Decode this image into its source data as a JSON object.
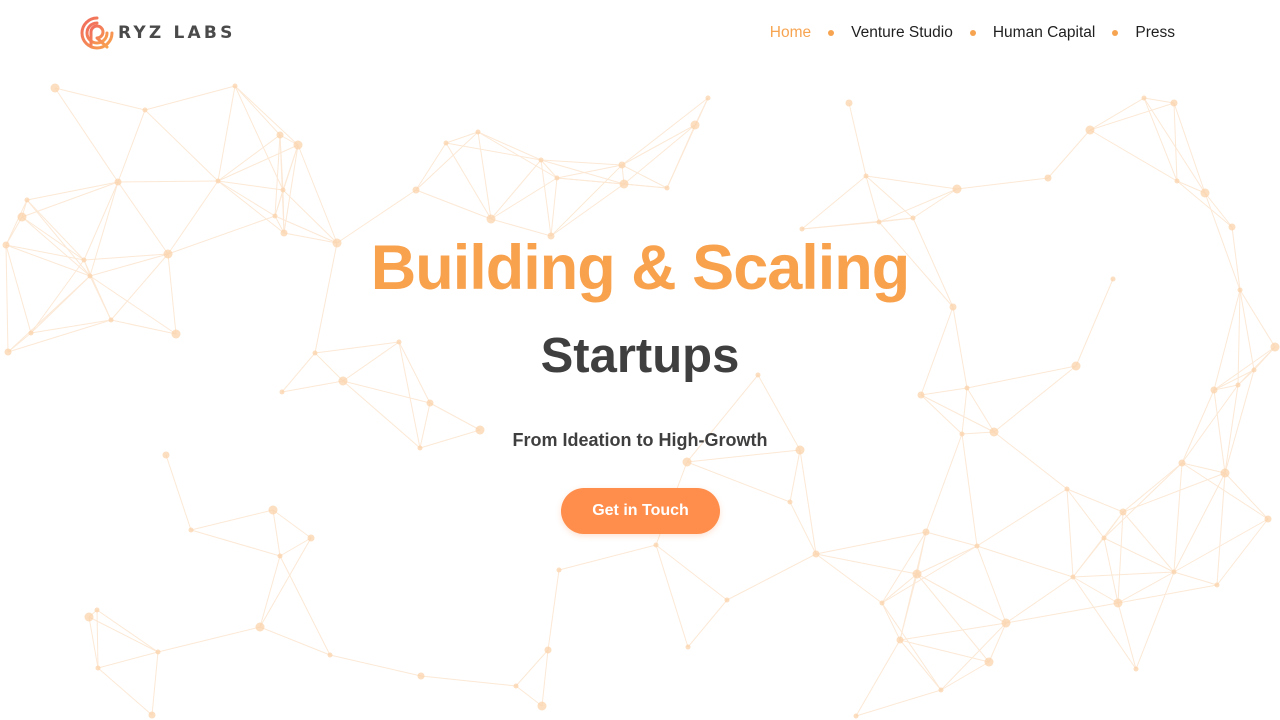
{
  "brand": {
    "name": "RYZ LABS",
    "logo_icon": "ryz-logo-icon",
    "gradient_start": "#f06a5e",
    "gradient_end": "#f9a24e"
  },
  "nav": {
    "items": [
      {
        "label": "Home",
        "active": true
      },
      {
        "label": "Venture Studio",
        "active": false
      },
      {
        "label": "Human Capital",
        "active": false
      },
      {
        "label": "Press",
        "active": false
      }
    ],
    "separator_icon": "dot-separator-icon"
  },
  "hero": {
    "title": "Building & Scaling",
    "subtitle": "Startups",
    "tagline": "From Ideation to High-Growth",
    "cta_label": "Get in Touch",
    "background": "network-mesh-graphic"
  },
  "colors": {
    "accent": "#f9a24e",
    "button": "#ff8d4b",
    "nav_active": "#f7a451",
    "text_dark": "#3f3f3f",
    "background": "#ffffff",
    "mesh_line": "#f7c08a"
  }
}
